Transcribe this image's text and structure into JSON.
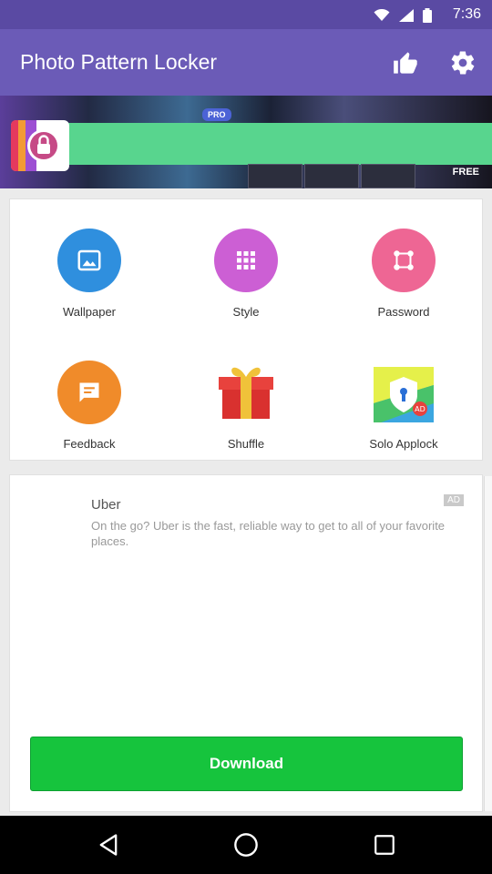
{
  "status_bar": {
    "time": "7:36"
  },
  "app_bar": {
    "title": "Photo Pattern Locker"
  },
  "banner": {
    "pro_badge": "PRO",
    "free_label": "FREE"
  },
  "features": [
    {
      "label": "Wallpaper",
      "icon": "image-icon",
      "color": "#2f8fde"
    },
    {
      "label": "Style",
      "icon": "grid-icon",
      "color": "#cc5fd4"
    },
    {
      "label": "Password",
      "icon": "pattern-icon",
      "color": "#ee6694"
    },
    {
      "label": "Feedback",
      "icon": "message-icon",
      "color": "#f08b2a"
    },
    {
      "label": "Shuffle",
      "icon": "gift-icon",
      "color": "#e8423d"
    },
    {
      "label": "Solo Applock",
      "icon": "shield-lock-icon",
      "color": "#3ba6e0"
    }
  ],
  "ad": {
    "advertiser": "Uber",
    "badge": "AD",
    "description": "On the go? Uber is the fast, reliable way to get to all of your favorite places.",
    "cta": "Download"
  },
  "colors": {
    "app_bar": "#6b5bb7",
    "status_bar": "#5a4aa3",
    "cta": "#16c43d"
  }
}
